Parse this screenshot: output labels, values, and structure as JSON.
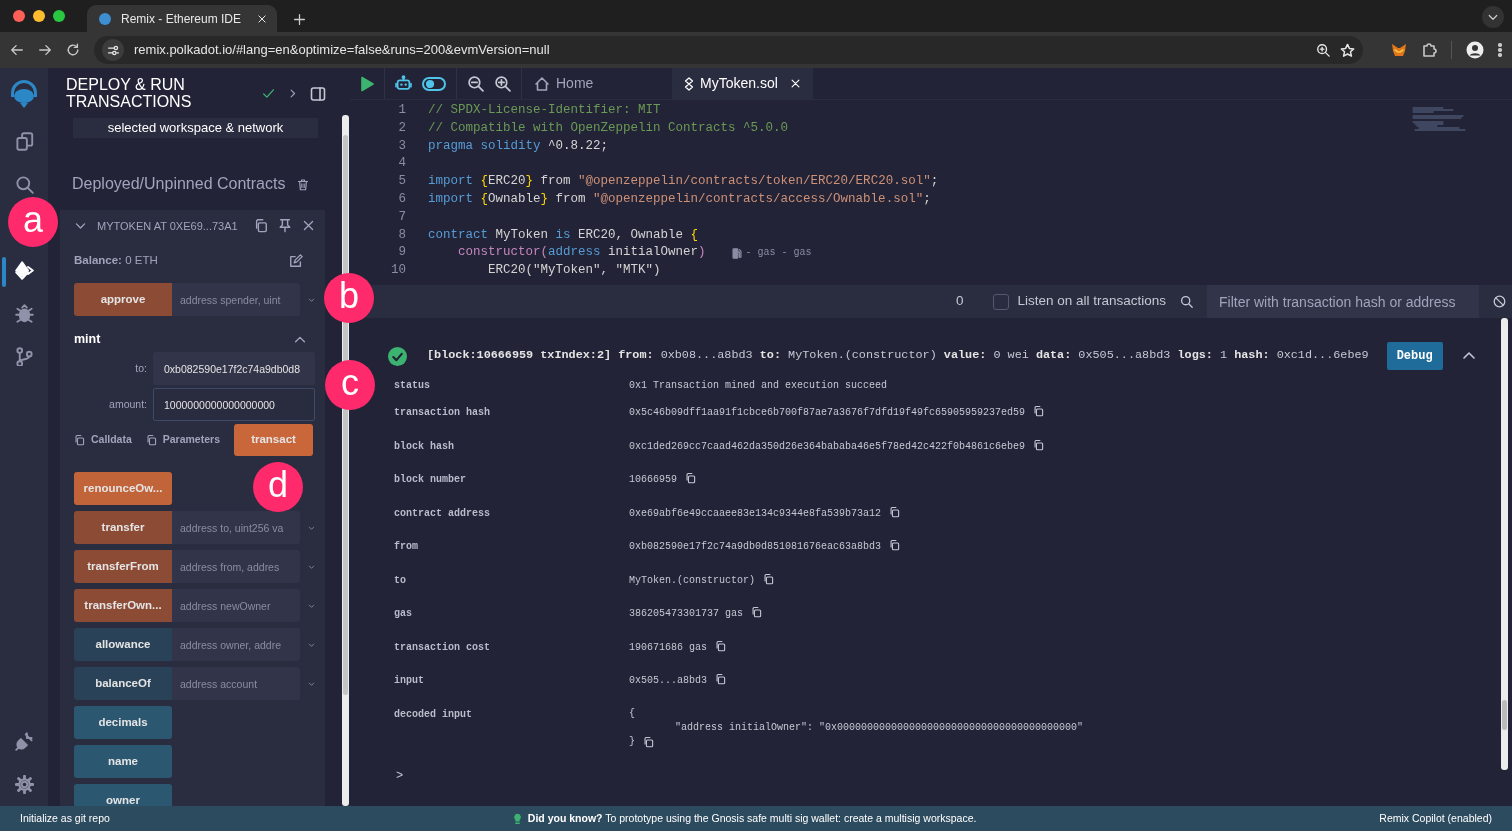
{
  "browser": {
    "tab_title": "Remix - Ethereum IDE",
    "url": "remix.polkadot.io/#lang=en&optimize=false&runs=200&evmVersion=null"
  },
  "icon_rail": {
    "items": [
      {
        "kind": "files",
        "selected": false
      },
      {
        "kind": "search",
        "selected": false
      },
      {
        "kind": "deploy",
        "selected": true
      },
      {
        "kind": "debug",
        "selected": false
      },
      {
        "kind": "git",
        "selected": false
      }
    ],
    "bottom_items": [
      {
        "kind": "plugin"
      },
      {
        "kind": "settings"
      }
    ]
  },
  "side_panel": {
    "title": "DEPLOY & RUN TRANSACTIONS",
    "workspace_note": "selected workspace & network",
    "section_title": "Deployed/Unpinned Contracts",
    "contract": {
      "title": "MYTOKEN AT 0XE69...73A1",
      "expanded": true,
      "balance": "**Balance:** 0 ETH",
      "functions": [
        {
          "name": "approve",
          "kind": "write",
          "placeholder": "address spender, uint",
          "expanded": false
        },
        {
          "name": "mint",
          "kind": "write",
          "expanded": true,
          "params": [
            {
              "label": "to:",
              "value": "0xb082590e17f2c74a9db0d8"
            },
            {
              "label": "amount:",
              "value": "1000000000000000000"
            }
          ],
          "actions": [
            "Calldata",
            "Parameters"
          ],
          "submit": "transact"
        },
        {
          "name": "renounceOw...",
          "kind": "write"
        },
        {
          "name": "transfer",
          "kind": "write",
          "placeholder": "address to, uint256 va",
          "expanded": false
        },
        {
          "name": "transferFrom",
          "kind": "write",
          "placeholder": "address from, addres",
          "expanded": false
        },
        {
          "name": "transferOwn...",
          "kind": "write",
          "placeholder": "address newOwner",
          "expanded": false
        },
        {
          "name": "allowance",
          "kind": "read",
          "placeholder": "address owner, addre",
          "expanded": false
        },
        {
          "name": "balanceOf",
          "kind": "read",
          "placeholder": "address account",
          "expanded": false
        },
        {
          "name": "decimals",
          "kind": "read"
        },
        {
          "name": "name",
          "kind": "read"
        },
        {
          "name": "owner",
          "kind": "read"
        }
      ]
    }
  },
  "editor": {
    "tabs": [
      {
        "kind": "home",
        "label": "Home",
        "selected": false
      },
      {
        "kind": "file",
        "label": "MyToken.sol",
        "selected": true
      }
    ],
    "lines": [
      {
        "number": "1",
        "segments": [
          {
            "kind": "comment",
            "text": "// SPDX-License-Identifier: MIT"
          }
        ]
      },
      {
        "number": "2",
        "segments": [
          {
            "kind": "comment",
            "text": "// Compatible with OpenZeppelin Contracts ^5.0.0"
          }
        ]
      },
      {
        "number": "3",
        "segments": [
          {
            "kind": "keyword",
            "text": "pragma solidity"
          },
          {
            "kind": "plain",
            "text": " ^0.8.22;"
          }
        ]
      },
      {
        "number": "4"
      },
      {
        "number": "5",
        "segments": [
          {
            "kind": "keyword",
            "text": "import "
          },
          {
            "kind": "brace",
            "text": "{"
          },
          {
            "kind": "plain",
            "text": "ERC20"
          },
          {
            "kind": "brace",
            "text": "}"
          },
          {
            "kind": "plain",
            "text": " from "
          },
          {
            "kind": "string",
            "text": "\"@openzeppelin/contracts/token/ERC20/ERC20.sol\""
          },
          {
            "kind": "plain",
            "text": ";"
          }
        ]
      },
      {
        "number": "6",
        "segments": [
          {
            "kind": "keyword",
            "text": "import "
          },
          {
            "kind": "brace",
            "text": "{"
          },
          {
            "kind": "plain",
            "text": "Ownable"
          },
          {
            "kind": "brace",
            "text": "}"
          },
          {
            "kind": "plain",
            "text": " from "
          },
          {
            "kind": "string",
            "text": "\"@openzeppelin/contracts/access/Ownable.sol\""
          },
          {
            "kind": "plain",
            "text": ";"
          }
        ]
      },
      {
        "number": "7"
      },
      {
        "number": "8",
        "segments": [
          {
            "kind": "keyword",
            "text": "contract"
          },
          {
            "kind": "plain",
            "text": " MyToken "
          },
          {
            "kind": "keyword",
            "text": "is"
          },
          {
            "kind": "plain",
            "text": " ERC20, Ownable "
          },
          {
            "kind": "brace",
            "text": "{"
          }
        ]
      },
      {
        "number": "9",
        "segments": [
          {
            "kind": "func",
            "text": "    constructor("
          },
          {
            "kind": "keyword",
            "text": "address"
          },
          {
            "kind": "plain",
            "text": " initialOwner"
          },
          {
            "kind": "func",
            "text": ")"
          }
        ],
        "hint": "- gas - gas"
      },
      {
        "number": "10",
        "segments": [
          {
            "kind": "plain",
            "text": "        ERC20(\"MyToken\", \"MTK\")"
          }
        ]
      }
    ]
  },
  "terminal": {
    "count": "0",
    "listen_label": "Listen on all transactions",
    "listen_checked": false,
    "filter_placeholder": "Filter with transaction hash or address",
    "transactions": [
      {
        "expanded": true,
        "summary": "**[block:10666959 txIndex:2]  from:** 0xb08...a8bd3 **to:** MyToken.(constructor) **value:** 0 wei **data:** 0x505...a8bd3 **logs:** 1 **hash:** 0xc1d...6ebe9",
        "debug": "Debug",
        "details": [
          {
            "key": "status",
            "value": "0x1 Transaction mined and execution succeed",
            "copy": false
          },
          {
            "key": "transaction hash",
            "value": "0x5c46b09dff1aa91f1cbce6b700f87ae7a3676f7dfd19f49fc65905959237ed59",
            "copy": true
          },
          {
            "key": "block hash",
            "value": "0xc1ded269cc7caad462da350d26e364bababa46e5f78ed42c422f0b4861c6ebe9",
            "copy": true
          },
          {
            "key": "block number",
            "value": "10666959",
            "copy": true
          },
          {
            "key": "contract address",
            "value": "0xe69abf6e49ccaaee83e134c9344e8fa539b73a12",
            "copy": true
          },
          {
            "key": "from",
            "value": "0xb082590e17f2c74a9db0d851081676eac63a8bd3",
            "copy": true
          },
          {
            "key": "to",
            "value": "MyToken.(constructor)",
            "copy": true
          },
          {
            "key": "gas",
            "value": "386205473301737 gas",
            "copy": true
          },
          {
            "key": "transaction cost",
            "value": "190671686 gas",
            "copy": true
          },
          {
            "key": "input",
            "value": "0x505...a8bd3",
            "copy": true
          },
          {
            "key": "decoded input",
            "lines": [
              "{",
              "\"address initialOwner\": \"0x0000000000000000000000000000000000000000\"",
              "}"
            ],
            "copy": true
          }
        ]
      }
    ],
    "prompt": ">"
  },
  "status_bar": {
    "left": "Initialize as git repo",
    "tip": "**Did you know?** To prototype using the Gnosis safe multi sig wallet: create a multisig workspace.",
    "right": "Remix Copilot (enabled)"
  },
  "annotations": [
    {
      "label": "a"
    },
    {
      "label": "b"
    },
    {
      "label": "c"
    },
    {
      "label": "d"
    }
  ]
}
